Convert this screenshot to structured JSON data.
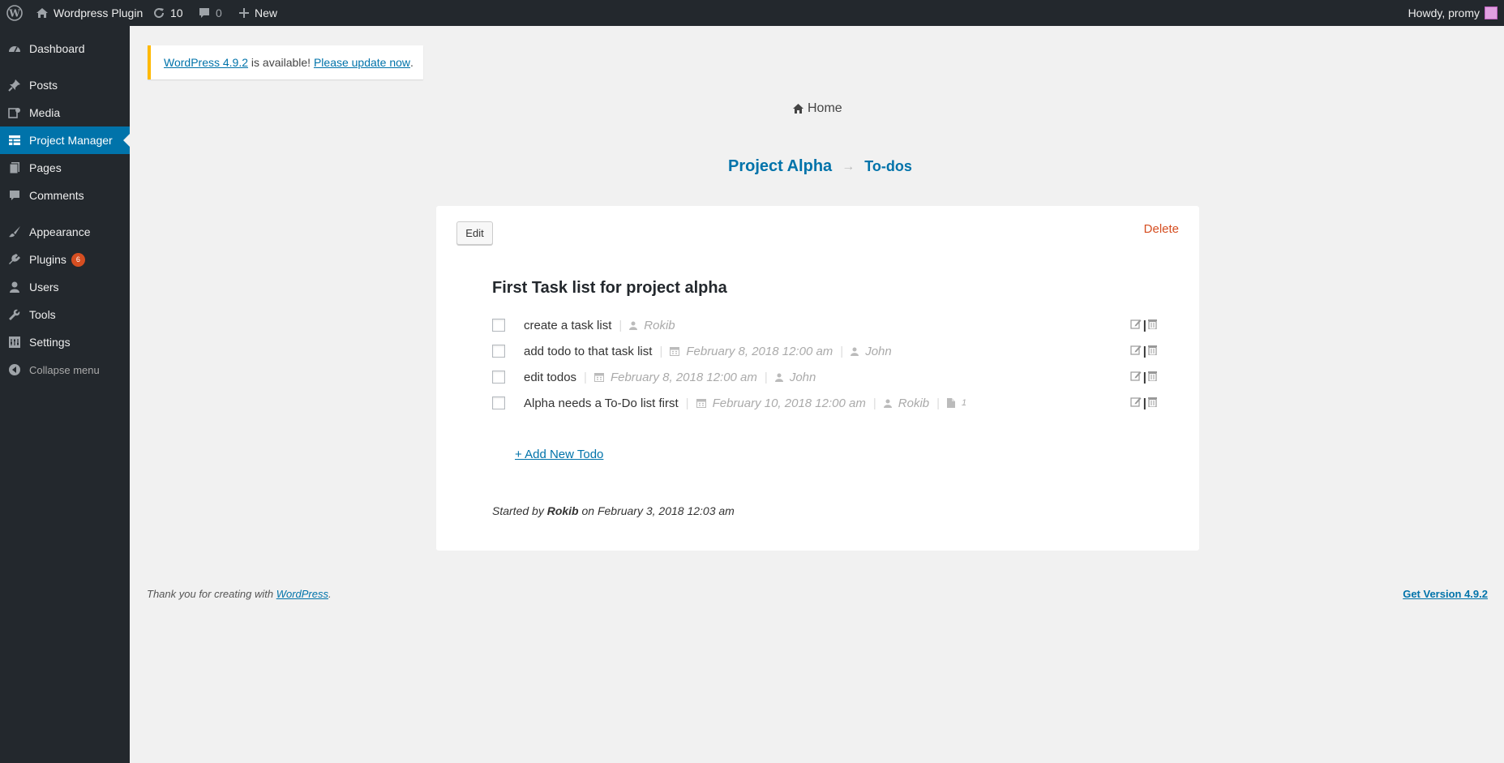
{
  "adminbar": {
    "site_name": "Wordpress Plugin",
    "updates_count": "10",
    "comments_count": "0",
    "new_label": "New",
    "howdy": "Howdy, promy"
  },
  "sidebar": {
    "items": [
      {
        "label": "Dashboard",
        "icon": "dashboard-icon"
      },
      {
        "label": "Posts",
        "icon": "pin-icon"
      },
      {
        "label": "Media",
        "icon": "media-icon"
      },
      {
        "label": "Project Manager",
        "icon": "table-icon",
        "active": true
      },
      {
        "label": "Pages",
        "icon": "pages-icon"
      },
      {
        "label": "Comments",
        "icon": "comment-icon"
      },
      {
        "label": "Appearance",
        "icon": "brush-icon"
      },
      {
        "label": "Plugins",
        "icon": "plugin-icon",
        "badge": "6"
      },
      {
        "label": "Users",
        "icon": "user-icon"
      },
      {
        "label": "Tools",
        "icon": "wrench-icon"
      },
      {
        "label": "Settings",
        "icon": "settings-icon"
      }
    ],
    "collapse_label": "Collapse menu"
  },
  "notice": {
    "version_link": "WordPress 4.9.2",
    "middle_text": " is available! ",
    "update_link": "Please update now",
    "end_text": "."
  },
  "breadcrumb": {
    "home": "Home",
    "project": "Project Alpha",
    "arrow": "→",
    "section": "To-dos"
  },
  "card": {
    "edit_label": "Edit",
    "delete_label": "Delete",
    "list_title": "First Task list for project alpha",
    "tasks": [
      {
        "title": "create a task list",
        "date": "",
        "assignee": "Rokib",
        "files": ""
      },
      {
        "title": "add todo to that task list",
        "date": "February 8, 2018 12:00 am",
        "assignee": "John",
        "files": ""
      },
      {
        "title": "edit todos",
        "date": "February 8, 2018 12:00 am",
        "assignee": "John",
        "files": ""
      },
      {
        "title": "Alpha needs a To-Do list first",
        "date": "February 10, 2018 12:00 am",
        "assignee": "Rokib",
        "files": "1"
      }
    ],
    "add_todo": "+ Add New Todo",
    "started_prefix": "Started by ",
    "started_by": "Rokib",
    "started_suffix": " on February 3, 2018 12:03 am"
  },
  "footer": {
    "thanks_prefix": "Thank you for creating with ",
    "thanks_link": "WordPress",
    "thanks_suffix": ".",
    "version_link": "Get Version 4.9.2"
  },
  "colors": {
    "accent": "#0073aa",
    "delete": "#d54e21",
    "notice_border": "#ffb900",
    "sidebar_bg": "#23282d"
  }
}
